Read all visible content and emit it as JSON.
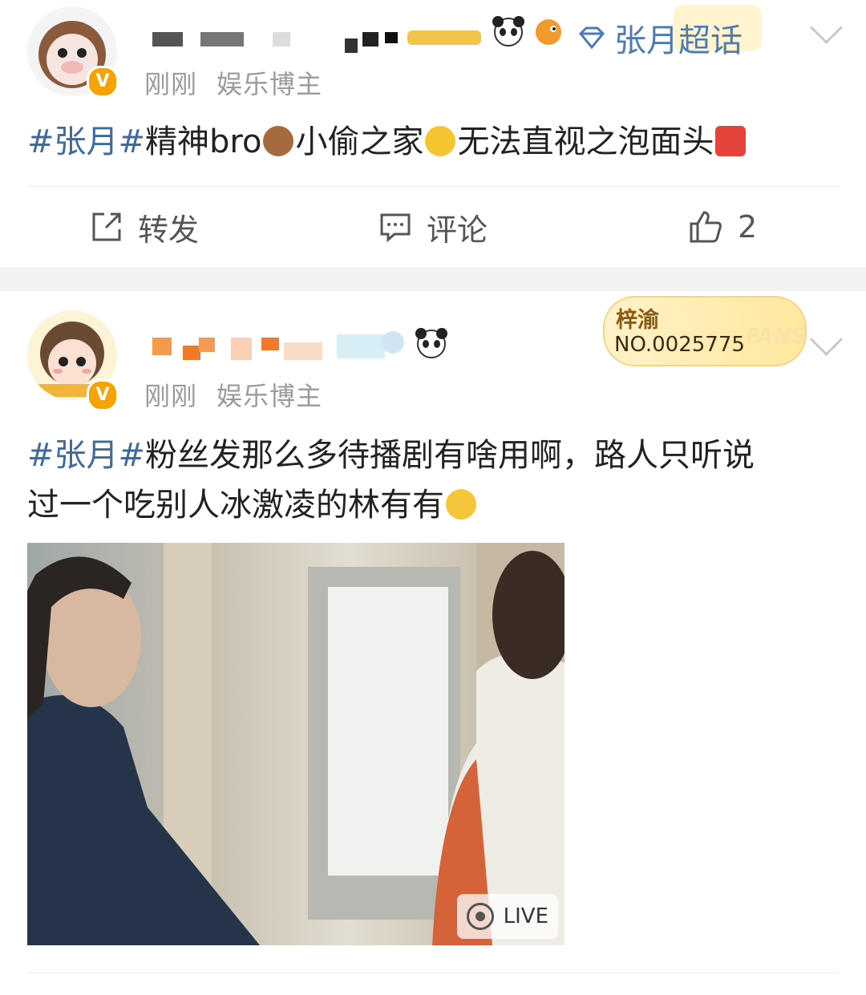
{
  "post1": {
    "time": "刚刚",
    "role": "娱乐博主",
    "supertopic": "张月超话",
    "text": {
      "tag": "#张月#",
      "part1": "精神bro",
      "part2": "小偷之家",
      "part3": "无法直视之泡面头"
    },
    "actions": {
      "repost": "转发",
      "comment": "评论",
      "like_count": "2"
    }
  },
  "post2": {
    "time": "刚刚",
    "role": "娱乐博主",
    "fans_badge": {
      "name": "梓渝",
      "number": "NO.0025775",
      "label": "FANS"
    },
    "text": {
      "tag": "#张月#",
      "line1": "粉丝发那么多待播剧有啥用啊，路人只听说",
      "line2": "过一个吃别人冰激凌的林有有"
    },
    "media": {
      "live_label": "LIVE"
    }
  },
  "colors": {
    "hashtag": "#3f6a9e",
    "vip_badge": "#f6a300",
    "gap": "#f2f2f2"
  }
}
